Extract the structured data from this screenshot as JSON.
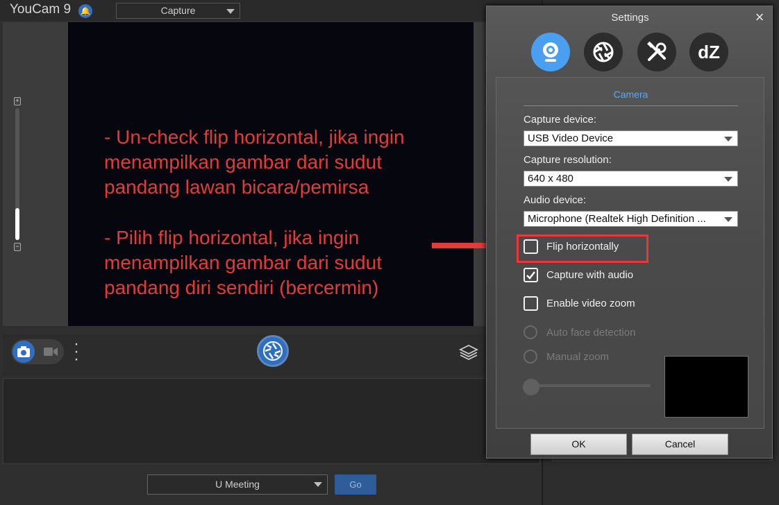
{
  "app": {
    "title": "YouCam 9",
    "mode_select": "Capture",
    "meeting_select": "U Meeting",
    "go_label": "Go"
  },
  "overlay": {
    "line1": "- Un-check flip horizontal, jika ingin",
    "line2": "menampilkan gambar dari sudut",
    "line3": "pandang lawan bicara/pemirsa",
    "line4": "- Pilih flip horizontal, jika ingin",
    "line5": "menampilkan gambar dari sudut",
    "line6": "pandang diri sendiri (bercermin)"
  },
  "settings": {
    "title": "Settings",
    "tabs": [
      "webcam-icon",
      "aperture-icon",
      "tools-icon",
      "dz-icon"
    ],
    "dz_label": "dZ",
    "section_title": "Camera",
    "capture_device_label": "Capture device:",
    "capture_device_value": "USB Video Device",
    "capture_resolution_label": "Capture resolution:",
    "capture_resolution_value": "640 x 480",
    "audio_device_label": "Audio device:",
    "audio_device_value": "Microphone (Realtek High Definition ...",
    "flip_horizontally": {
      "label": "Flip horizontally",
      "checked": false
    },
    "capture_with_audio": {
      "label": "Capture with audio",
      "checked": true
    },
    "enable_video_zoom": {
      "label": "Enable video zoom",
      "checked": false
    },
    "auto_face_detection": {
      "label": "Auto face detection",
      "enabled": false
    },
    "manual_zoom": {
      "label": "Manual zoom",
      "enabled": false
    },
    "ok_label": "OK",
    "cancel_label": "Cancel"
  },
  "colors": {
    "accent": "#4a9ff0",
    "annotation": "#e63a3a",
    "section_title": "#5aa8f5"
  }
}
